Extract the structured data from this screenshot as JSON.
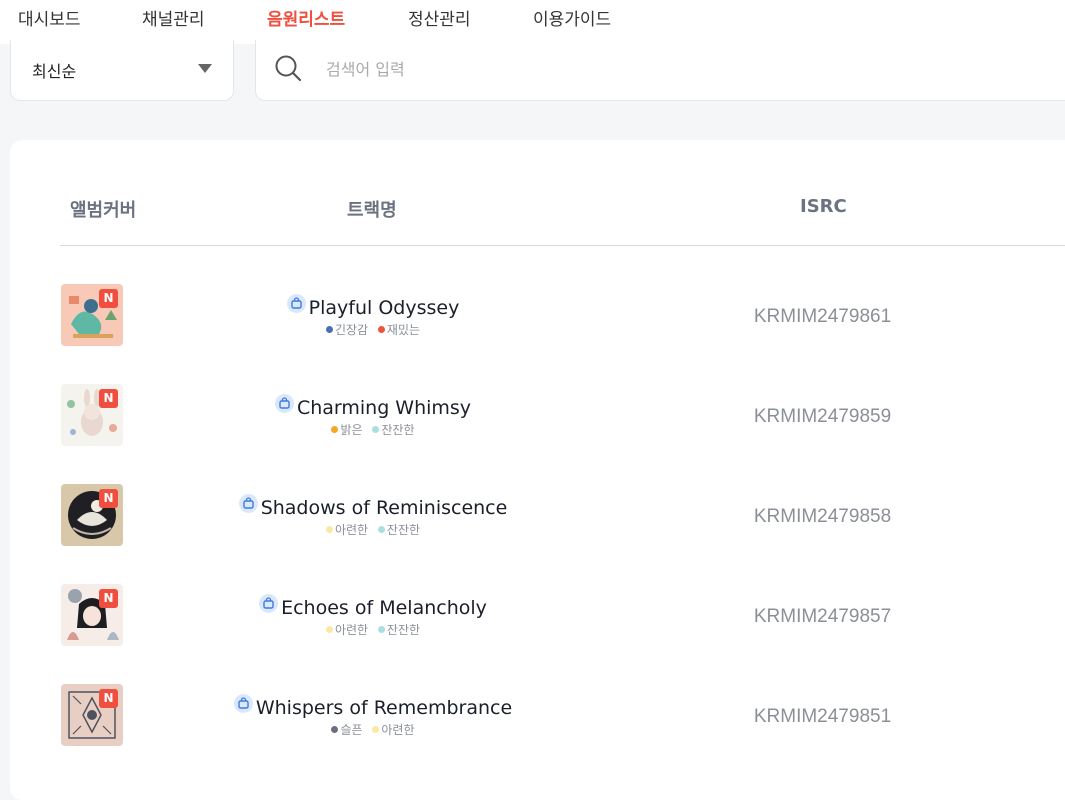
{
  "nav": {
    "tabs": [
      {
        "label": "대시보드"
      },
      {
        "label": "채널관리"
      },
      {
        "label": "음원리스트"
      },
      {
        "label": "정산관리"
      },
      {
        "label": "이용가이드"
      }
    ],
    "active_tab": "음원리스트"
  },
  "filters": {
    "sort_value": "최신순",
    "search_placeholder": "검색어 입력"
  },
  "table": {
    "headers": {
      "cover": "앨범커버",
      "track": "트랙명",
      "isrc": "ISRC"
    },
    "badge_label": "N",
    "rows": [
      {
        "title": "Playful Odyssey",
        "isrc": "KRMIM2479861",
        "tags": [
          {
            "label": "긴장감",
            "color": "#4a6fb5"
          },
          {
            "label": "재밌는",
            "color": "#e8553b"
          }
        ],
        "cover_icon": "dragon-illustration-cover"
      },
      {
        "title": "Charming Whimsy",
        "isrc": "KRMIM2479859",
        "tags": [
          {
            "label": "밝은",
            "color": "#f5a623"
          },
          {
            "label": "잔잔한",
            "color": "#a8dfe0"
          }
        ],
        "cover_icon": "rabbit-illustration-cover"
      },
      {
        "title": "Shadows of Reminiscence",
        "isrc": "KRMIM2479858",
        "tags": [
          {
            "label": "아련한",
            "color": "#fbe7a6"
          },
          {
            "label": "잔잔한",
            "color": "#a8dfe0"
          }
        ],
        "cover_icon": "moon-illustration-cover"
      },
      {
        "title": "Echoes of Melancholy",
        "isrc": "KRMIM2479857",
        "tags": [
          {
            "label": "아련한",
            "color": "#fbe7a6"
          },
          {
            "label": "잔잔한",
            "color": "#a8dfe0"
          }
        ],
        "cover_icon": "girl-illustration-cover"
      },
      {
        "title": "Whispers of Remembrance",
        "isrc": "KRMIM2479851",
        "tags": [
          {
            "label": "슬픈",
            "color": "#6b6f80"
          },
          {
            "label": "아련한",
            "color": "#fbe7a6"
          }
        ],
        "cover_icon": "pattern-illustration-cover"
      }
    ]
  },
  "colors": {
    "accent": "#f04e3e",
    "isrc_text": "#8b8f97"
  }
}
